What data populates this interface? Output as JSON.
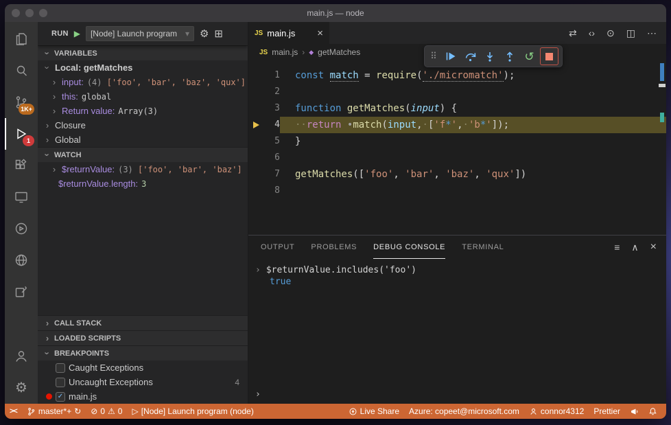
{
  "window": {
    "title": "main.js — node"
  },
  "colors": {
    "status_bar": "#cc6633",
    "badge_scm": "#bb6a1e",
    "badge_debug": "#cf3b3b",
    "debug_blue": "#75beff",
    "debug_green": "#89d185",
    "debug_red": "#f48771",
    "current_line_highlight": "#5a562c",
    "breakpoint_red": "#e51400"
  },
  "icons": {
    "chevron": "›",
    "chevron_down": "▾",
    "close": "×",
    "ellipsis": "⋯",
    "compare": "⇄",
    "code_nav": "‹›",
    "step_dot": "⊙",
    "split": "◫",
    "gear": "⚙",
    "play_green": "▶",
    "play_outline": "▷",
    "restart": "↺",
    "sync": "↻",
    "error": "⊘",
    "warning": "⚠",
    "filter": "≡",
    "collapse_up": "∧",
    "add_config": "⊞",
    "check": "✓",
    "js": "JS",
    "remote": "><",
    "grip": "⠿",
    "symbol_method": "◆"
  },
  "activity_bar": {
    "badges": {
      "source_control": "1K+",
      "debug": "1"
    }
  },
  "sidebar": {
    "run_label": "RUN",
    "launch_config": "[Node] Launch program",
    "variables_title": "VARIABLES",
    "scope_label": "Local: getMatches",
    "variables": [
      {
        "name": "input:",
        "prefix": "(4) ",
        "value": "['foo', 'bar', 'baz', 'qux']"
      },
      {
        "name": "this:",
        "prefix": "",
        "value": "global"
      },
      {
        "name": "Return value:",
        "prefix": "",
        "value": "Array(3)"
      }
    ],
    "collapsed_scopes": [
      "Closure",
      "Global"
    ],
    "watch_title": "WATCH",
    "watch": [
      {
        "name": "$returnValue:",
        "prefix": "(3) ",
        "value": "['foo', 'bar', 'baz']"
      },
      {
        "name": "$returnValue.length:",
        "prefix": "",
        "value": "3"
      }
    ],
    "call_stack_title": "CALL STACK",
    "loaded_scripts_title": "LOADED SCRIPTS",
    "breakpoints_title": "BREAKPOINTS",
    "breakpoints": [
      {
        "label": "Caught Exceptions"
      },
      {
        "label": "Uncaught Exceptions",
        "count": "4"
      },
      {
        "label": "main.js"
      }
    ]
  },
  "editor": {
    "tab": "main.js",
    "breadcrumb_file": "main.js",
    "breadcrumb_symbol": "getMatches",
    "lines": [
      {
        "n": "1",
        "tokens": [
          {
            "t": "const",
            "c": "kw"
          },
          {
            "t": " ",
            "c": "pl"
          },
          {
            "t": "match",
            "c": "var und"
          },
          {
            "t": " = ",
            "c": "pl"
          },
          {
            "t": "require",
            "c": "fn"
          },
          {
            "t": "(",
            "c": "pl"
          },
          {
            "t": "'./micromatch'",
            "c": "str und"
          },
          {
            "t": ");",
            "c": "pl"
          }
        ]
      },
      {
        "n": "2",
        "tokens": []
      },
      {
        "n": "3",
        "tokens": [
          {
            "t": "function",
            "c": "kw"
          },
          {
            "t": " ",
            "c": "pl"
          },
          {
            "t": "getMatches",
            "c": "fn"
          },
          {
            "t": "(",
            "c": "pl"
          },
          {
            "t": "input",
            "c": "param"
          },
          {
            "t": ") {",
            "c": "pl"
          }
        ]
      },
      {
        "n": "4",
        "current": true,
        "tokens": [
          {
            "t": "··",
            "c": "ws"
          },
          {
            "t": "return",
            "c": "kw2"
          },
          {
            "t": " ",
            "c": "pl"
          },
          {
            "t": "•",
            "c": "bpdot"
          },
          {
            "t": "match",
            "c": "fn"
          },
          {
            "t": "(",
            "c": "pl"
          },
          {
            "t": "input",
            "c": "var"
          },
          {
            "t": ",",
            "c": "pl"
          },
          {
            "t": "·",
            "c": "ws"
          },
          {
            "t": "[",
            "c": "pl"
          },
          {
            "t": "'f",
            "c": "str"
          },
          {
            "t": "*",
            "c": "glob"
          },
          {
            "t": "'",
            "c": "str"
          },
          {
            "t": ",",
            "c": "pl"
          },
          {
            "t": "·",
            "c": "ws"
          },
          {
            "t": "'b",
            "c": "str"
          },
          {
            "t": "*",
            "c": "glob"
          },
          {
            "t": "'",
            "c": "str"
          },
          {
            "t": "]);",
            "c": "pl"
          }
        ]
      },
      {
        "n": "5",
        "tokens": [
          {
            "t": "}",
            "c": "pl"
          }
        ]
      },
      {
        "n": "6",
        "tokens": []
      },
      {
        "n": "7",
        "tokens": [
          {
            "t": "getMatches",
            "c": "fn"
          },
          {
            "t": "([",
            "c": "pl"
          },
          {
            "t": "'foo'",
            "c": "str"
          },
          {
            "t": ", ",
            "c": "pl"
          },
          {
            "t": "'bar'",
            "c": "str"
          },
          {
            "t": ", ",
            "c": "pl"
          },
          {
            "t": "'baz'",
            "c": "str"
          },
          {
            "t": ", ",
            "c": "pl"
          },
          {
            "t": "'qux'",
            "c": "str"
          },
          {
            "t": "])",
            "c": "pl"
          }
        ]
      },
      {
        "n": "8",
        "tokens": []
      }
    ]
  },
  "panel": {
    "tabs": [
      "OUTPUT",
      "PROBLEMS",
      "DEBUG CONSOLE",
      "TERMINAL"
    ],
    "console_expression": "$returnValue.includes('foo')",
    "console_result": "true"
  },
  "status_bar": {
    "branch": "master*+",
    "errors": "0",
    "warnings": "0",
    "launch": "[Node] Launch program (node)",
    "live_share": "Live Share",
    "azure": "Azure: copeet@microsoft.com",
    "account": "connor4312",
    "formatter": "Prettier"
  }
}
